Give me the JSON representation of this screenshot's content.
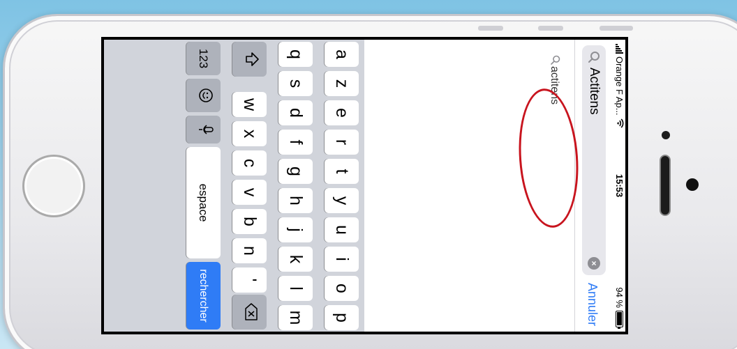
{
  "status_bar": {
    "carrier": "Orange F Ap...",
    "time": "15:53",
    "battery_percent": "94 %",
    "battery_level": 0.94
  },
  "search": {
    "value": "Actitens",
    "cancel_label": "Annuler",
    "clear_icon": "clear-icon"
  },
  "suggestions": [
    {
      "text": "actitens"
    }
  ],
  "annotation": {
    "color": "#c8141e"
  },
  "keyboard": {
    "row1": [
      "a",
      "z",
      "e",
      "r",
      "t",
      "y",
      "u",
      "i",
      "o",
      "p"
    ],
    "row2": [
      "q",
      "s",
      "d",
      "f",
      "g",
      "h",
      "j",
      "k",
      "l",
      "m"
    ],
    "row3": [
      "w",
      "x",
      "c",
      "v",
      "b",
      "n",
      "'"
    ],
    "shift_icon": "shift-icon",
    "backspace_icon": "backspace-icon",
    "numbers_label": "123",
    "emoji_icon": "emoji-icon",
    "mic_icon": "microphone-icon",
    "space_label": "espace",
    "search_label": "rechercher"
  },
  "colors": {
    "accent": "#2f7cf6",
    "keyboard_bg": "#d1d4db",
    "annotation": "#c8141e"
  }
}
